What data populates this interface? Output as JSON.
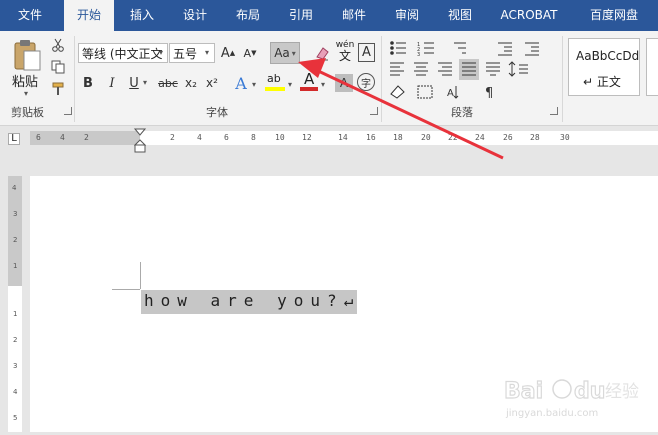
{
  "tabs": [
    "文件",
    "开始",
    "插入",
    "设计",
    "布局",
    "引用",
    "邮件",
    "审阅",
    "视图",
    "ACROBAT",
    "百度网盘"
  ],
  "active_tab": "开始",
  "clipboard": {
    "paste_label": "粘贴",
    "group_label": "剪贴板"
  },
  "font": {
    "font_name": "等线 (中文正文",
    "font_size": "五号",
    "change_case": "Aa",
    "wen_glyph": "wén",
    "wen_char": "文",
    "a_char": "A",
    "bold": "B",
    "italic": "I",
    "underline": "U",
    "strike": "abc",
    "subscript": "x₂",
    "superscript": "x²",
    "highlight": "ab",
    "char_shading": "A",
    "enclose": "字",
    "grow": "A",
    "shrink": "A",
    "group_label": "字体"
  },
  "paragraph": {
    "group_label": "段落"
  },
  "styles": {
    "sample": "AaBbCcDd",
    "name": "↵ 正文"
  },
  "ruler": {
    "ticks": [
      "6",
      "4",
      "2",
      "2",
      "4",
      "6",
      "8",
      "10",
      "12",
      "14",
      "16",
      "18",
      "20",
      "22",
      "24",
      "26",
      "28",
      "30"
    ]
  },
  "document": {
    "text": "how are you?↵"
  },
  "colors": {
    "accent": "#2b579a",
    "arrow": "#e8323b",
    "font_color": "#d22a2a",
    "highlight": "#ffff00"
  }
}
